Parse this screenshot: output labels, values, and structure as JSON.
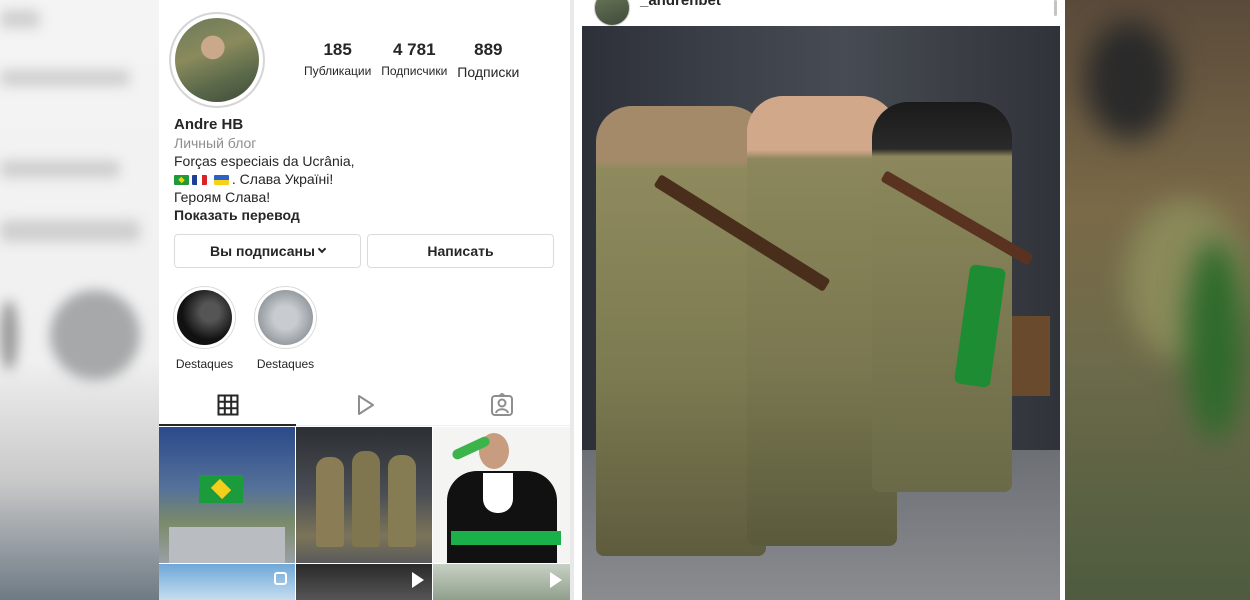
{
  "profile": {
    "stats": [
      {
        "value": "185",
        "label": "Публикации"
      },
      {
        "value": "4 781",
        "label": "Подписчики"
      },
      {
        "value": "889",
        "label": "Подписки"
      }
    ],
    "name": "Andre HB",
    "category": "Личный блог",
    "bio_line1": "Forças especiais da Ucrânia,",
    "bio_line2_text": ". Слава Україні!",
    "bio_line3": "Героям Слава!",
    "translate": "Показать перевод",
    "following_button": "Вы подписаны",
    "message_button": "Написать",
    "highlights": [
      {
        "label": "Destaques"
      },
      {
        "label": "Destaques"
      }
    ]
  },
  "post": {
    "username": "_andrehbet"
  },
  "colors": {
    "text": "#262626",
    "muted": "#8e8e8e",
    "border": "#dbdbdb"
  },
  "icons": [
    "grid-icon",
    "reels-icon",
    "tagged-icon",
    "chevron-down-icon",
    "play-icon",
    "multi-photo-icon"
  ]
}
